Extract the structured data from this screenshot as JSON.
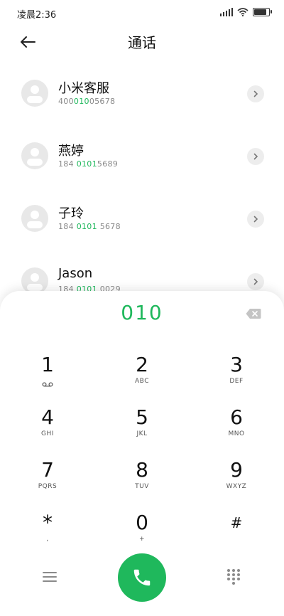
{
  "status": {
    "time": "凌晨2:36",
    "battery_level": 0.9
  },
  "header": {
    "title": "通话"
  },
  "contacts": [
    {
      "name": "小米客服",
      "number_parts": [
        "400",
        "010",
        "05678"
      ]
    },
    {
      "name": "燕婷",
      "number_parts": [
        "184 ",
        "0101",
        "5689"
      ]
    },
    {
      "name": "子玲",
      "number_parts": [
        "184 ",
        "0101",
        " 5678"
      ]
    },
    {
      "name": "Jason",
      "number_parts": [
        "184 ",
        "0101",
        " 0029"
      ]
    }
  ],
  "dialpad": {
    "entered": "010",
    "keys": [
      {
        "digit": "1",
        "letters": ""
      },
      {
        "digit": "2",
        "letters": "ABC"
      },
      {
        "digit": "3",
        "letters": "DEF"
      },
      {
        "digit": "4",
        "letters": "GHI"
      },
      {
        "digit": "5",
        "letters": "JKL"
      },
      {
        "digit": "6",
        "letters": "MNO"
      },
      {
        "digit": "7",
        "letters": "PQRS"
      },
      {
        "digit": "8",
        "letters": "TUV"
      },
      {
        "digit": "9",
        "letters": "WXYZ"
      },
      {
        "digit": "*",
        "letters": ","
      },
      {
        "digit": "0",
        "letters": "+"
      },
      {
        "digit": "#",
        "letters": ""
      }
    ]
  },
  "icons": {
    "back": "arrow-left-icon",
    "delete": "backspace-icon",
    "menu": "menu-icon",
    "call": "phone-icon",
    "keypad": "dialpad-icon",
    "voicemail": "voicemail-icon"
  },
  "colors": {
    "accent": "#1fb85c"
  }
}
